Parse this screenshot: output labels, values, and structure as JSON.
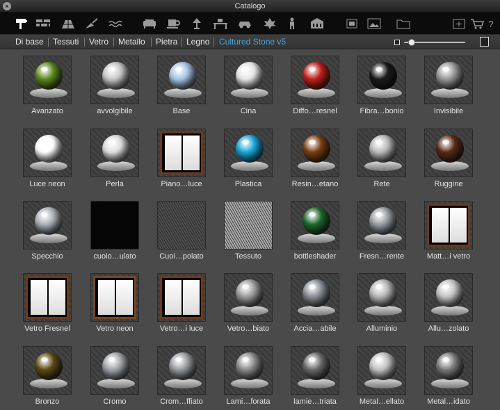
{
  "window": {
    "title": "Catalogo",
    "close_glyph": "×"
  },
  "toolbar": {
    "icons": [
      "paint-roller-icon",
      "brick-wall-icon",
      "roof-tiles-icon",
      "trowel-icon",
      "water-icon",
      "sofa-icon",
      "cup-icon",
      "lamp-icon",
      "desk-icon",
      "car-icon",
      "leaf-icon",
      "person-icon",
      "building-icon",
      "texture-icon",
      "image-icon",
      "folder-icon",
      "new-folder-icon",
      "cart-icon",
      "help-icon"
    ],
    "help_glyph": "?"
  },
  "breadcrumb": {
    "items": [
      "Di base",
      "Tessuti",
      "Vetro",
      "Metallo",
      "Pietra",
      "Legno",
      "Cultured Stone v5"
    ]
  },
  "colors": {
    "active_crumb": "#4aa3df",
    "background": "#4a4a4a",
    "toolbar": "#0c0c0c"
  },
  "materials": [
    {
      "label": "Avanzato",
      "kind": "sphere",
      "color": "#5c8a1e"
    },
    {
      "label": "avvolgibile",
      "kind": "sphere",
      "color": "#c9c9c9"
    },
    {
      "label": "Base",
      "kind": "sphere",
      "color": "#a8c6e8"
    },
    {
      "label": "Cina",
      "kind": "sphere",
      "color": "#e8e8e8"
    },
    {
      "label": "Diffo…resnel",
      "kind": "sphere",
      "color": "#c0201a"
    },
    {
      "label": "Fibra…bonio",
      "kind": "sphere",
      "color": "#1a1a1a"
    },
    {
      "label": "Invisibile",
      "kind": "sphere",
      "color": "#9a9a9a"
    },
    {
      "label": "Luce neon",
      "kind": "sphere",
      "color": "#ffffff"
    },
    {
      "label": "Perla",
      "kind": "sphere",
      "color": "#e0e0e0"
    },
    {
      "label": "Piano…luce",
      "kind": "window",
      "color": "#6b3a1b"
    },
    {
      "label": "Plastica",
      "kind": "sphere",
      "color": "#1aa6d8"
    },
    {
      "label": "Resin…etano",
      "kind": "sphere",
      "color": "#7a3f14"
    },
    {
      "label": "Rete",
      "kind": "sphere",
      "color": "#bdbdbd"
    },
    {
      "label": "Ruggine",
      "kind": "sphere",
      "color": "#5a2a16"
    },
    {
      "label": "Specchio",
      "kind": "sphere",
      "color": "#aeb4ba"
    },
    {
      "label": "cuoio…ulato",
      "kind": "texture",
      "color": "#1c1c1c"
    },
    {
      "label": "Cuoi…polato",
      "kind": "texture",
      "color": "#8c8c8c"
    },
    {
      "label": "Tessuto",
      "kind": "texture",
      "color": "#d0d0d0"
    },
    {
      "label": "bottleshader",
      "kind": "sphere",
      "color": "#1f6a2c"
    },
    {
      "label": "Fresn…rente",
      "kind": "sphere",
      "color": "#9aa0a6"
    },
    {
      "label": "Matt…i vetro",
      "kind": "window",
      "color": "#6b3a1b"
    },
    {
      "label": "Vetro Fresnel",
      "kind": "window",
      "color": "#6b3a1b"
    },
    {
      "label": "Vetro neon",
      "kind": "window",
      "color": "#7a4520"
    },
    {
      "label": "Vetro…i luce",
      "kind": "window",
      "color": "#6b3a1b"
    },
    {
      "label": "Vetro…biato",
      "kind": "sphere",
      "color": "#9e9e9e"
    },
    {
      "label": "Accia…abile",
      "kind": "sphere",
      "color": "#8a9096"
    },
    {
      "label": "Alluminio",
      "kind": "sphere",
      "color": "#b8b8b8"
    },
    {
      "label": "Allu…zolato",
      "kind": "sphere",
      "color": "#c6c6c6"
    },
    {
      "label": "Bronzo",
      "kind": "sphere",
      "color": "#5e4a14"
    },
    {
      "label": "Cromo",
      "kind": "sphere",
      "color": "#a4a8ac"
    },
    {
      "label": "Crom…ffiato",
      "kind": "sphere",
      "color": "#9a9ea2"
    },
    {
      "label": "Lami…forata",
      "kind": "sphere",
      "color": "#8c8c8c"
    },
    {
      "label": "lamie…triata",
      "kind": "sphere",
      "color": "#6c6c6c"
    },
    {
      "label": "Metal…ellato",
      "kind": "sphere",
      "color": "#c4c4c4"
    },
    {
      "label": "Metal…idato",
      "kind": "sphere",
      "color": "#7c7c7c"
    }
  ]
}
